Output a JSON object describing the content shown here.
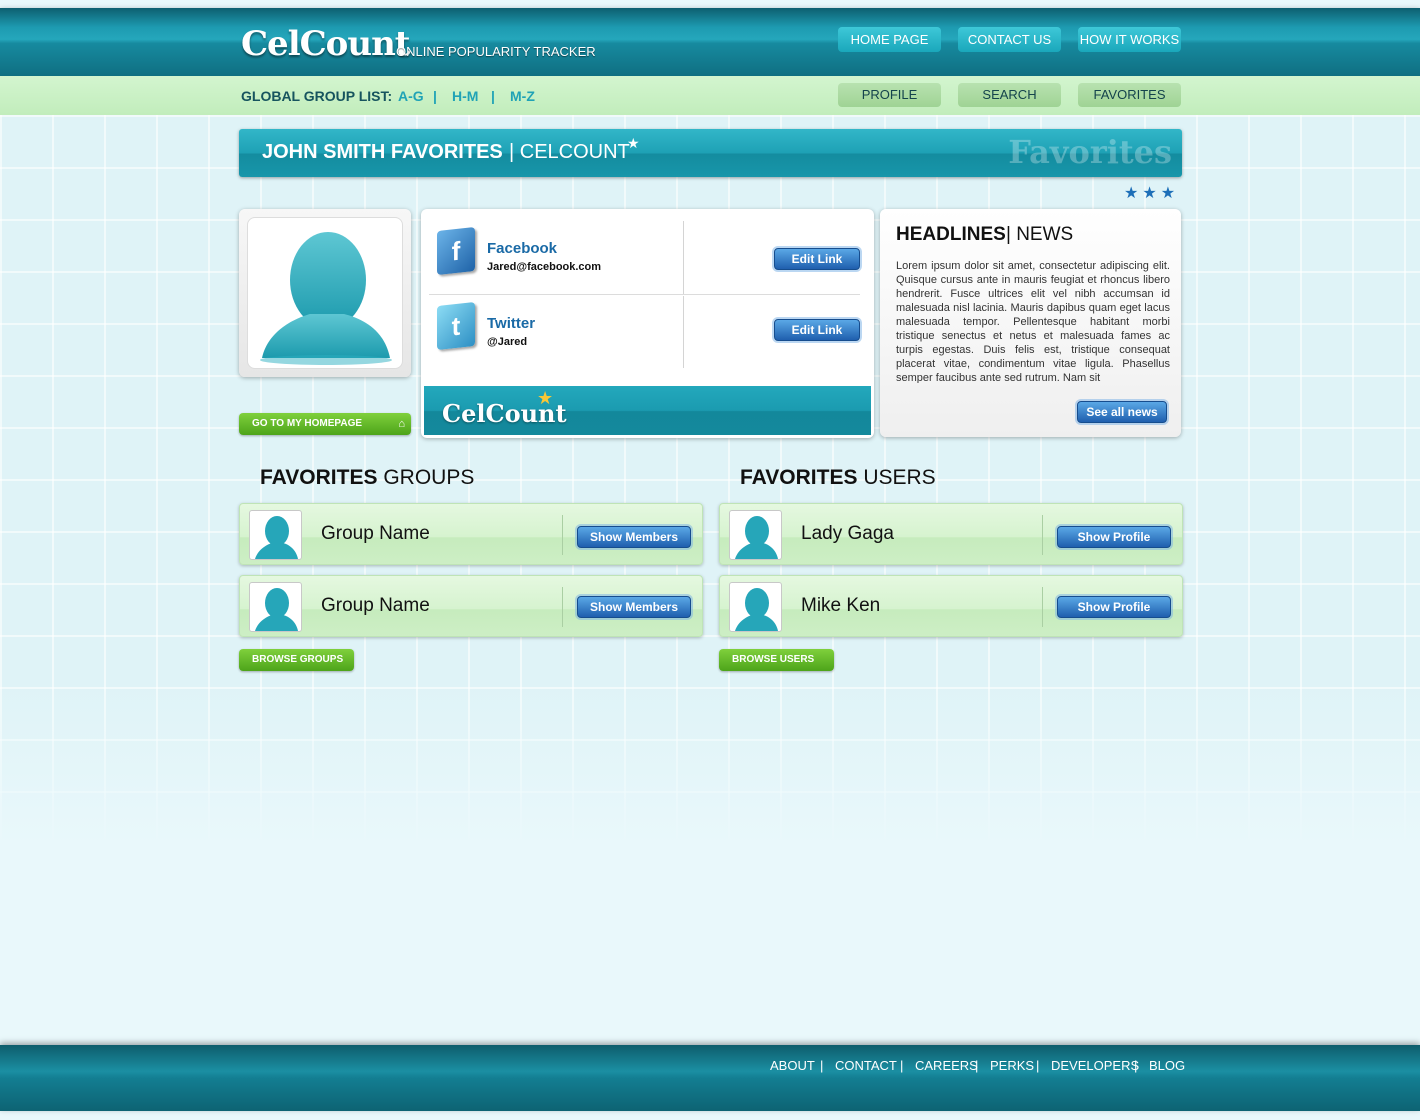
{
  "header": {
    "logo": "CelCount",
    "tagline": "ONLINE POPULARITY TRACKER",
    "nav": [
      "HOME PAGE",
      "CONTACT US",
      "HOW IT WORKS"
    ]
  },
  "subnav": {
    "label": "GLOBAL GROUP LIST:",
    "ranges": [
      "A-G",
      "H-M",
      "M-Z"
    ],
    "separator": "|",
    "buttons": [
      "PROFILE",
      "SEARCH",
      "FAVORITES"
    ]
  },
  "title_bar": {
    "main": "JOHN SMITH FAVORITES",
    "sub": "| CELCOUNT",
    "star": "★",
    "watermark": "Favorites",
    "rating_stars": "★★★"
  },
  "profile": {
    "homepage_button": "GO TO MY HOMEPAGE",
    "home_glyph": "⌂"
  },
  "social": {
    "accounts": [
      {
        "icon": "facebook-icon",
        "icon_char": "f",
        "name": "Facebook",
        "handle": "Jared@facebook.com",
        "button": "Edit Link"
      },
      {
        "icon": "twitter-icon",
        "icon_char": "t",
        "name": "Twitter",
        "handle": "@Jared",
        "button": "Edit Link"
      }
    ],
    "footer_logo": "CelCount",
    "footer_star": "★"
  },
  "news": {
    "title": "HEADLINES",
    "sub": "| NEWS",
    "body": "Lorem ipsum dolor sit amet, consectetur adipiscing elit. Quisque cursus ante in mauris feugiat et rhoncus libero hendrerit. Fusce ultrices elit vel nibh accumsan id malesuada nisl lacinia. Mauris dapibus quam eget lacus malesuada tempor. Pellentesque habitant morbi tristique senectus et netus et malesuada fames ac turpis egestas. Duis felis est, tristique consequat placerat vitae, condimentum vitae ligula. Phasellus semper faucibus ante sed rutrum. Nam sit",
    "button": "See all news"
  },
  "groups": {
    "heading_bold": "FAVORITES",
    "heading_rest": "GROUPS",
    "items": [
      {
        "name": "Group Name",
        "button": "Show  Members"
      },
      {
        "name": "Group Name",
        "button": "Show  Members"
      }
    ],
    "browse": "BROWSE GROUPS"
  },
  "users": {
    "heading_bold": "FAVORITES",
    "heading_rest": "USERS",
    "items": [
      {
        "name": "Lady Gaga",
        "button": "Show  Profile"
      },
      {
        "name": "Mike Ken",
        "button": "Show  Profile"
      }
    ],
    "browse": "BROWSE USERS"
  },
  "footer": {
    "links": [
      "ABOUT",
      "CONTACT",
      "CAREERS",
      "PERKS",
      "DEVELOPERS",
      "BLOG"
    ],
    "separator": "|"
  },
  "colors": {
    "header_teal": "#1d9ab0",
    "subnav_green": "#c2edbc",
    "button_blue": "#1f5fae",
    "button_green": "#4da41a"
  }
}
